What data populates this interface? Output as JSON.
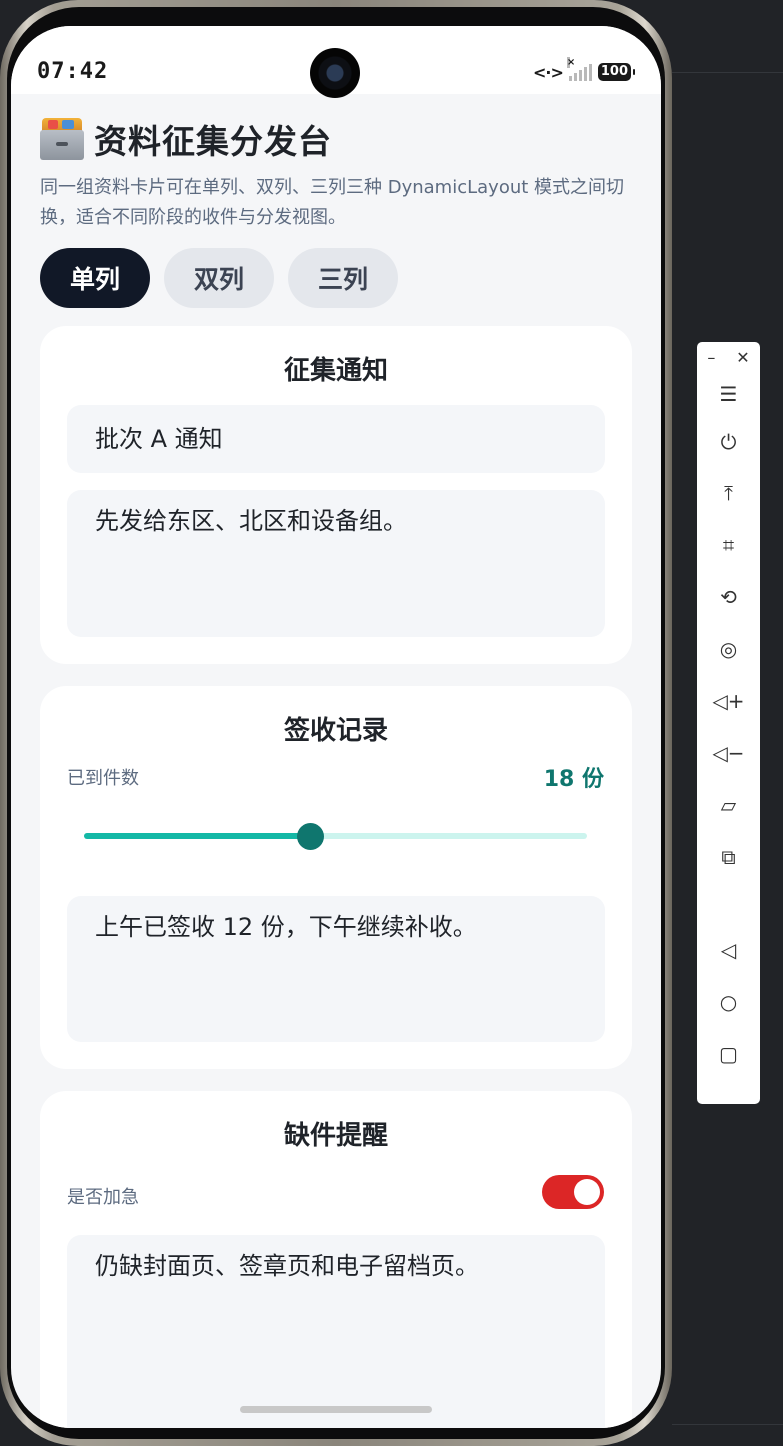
{
  "status_bar": {
    "time": "07:42",
    "battery": "100"
  },
  "header": {
    "title": "资料征集分发台",
    "subtitle": "同一组资料卡片可在单列、双列、三列三种 DynamicLayout 模式之间切换，适合不同阶段的收件与分发视图。"
  },
  "tabs": [
    {
      "label": "单列",
      "active": true
    },
    {
      "label": "双列",
      "active": false
    },
    {
      "label": "三列",
      "active": false
    }
  ],
  "cards": {
    "notice": {
      "title": "征集通知",
      "input_value": "批次 A 通知",
      "textarea_value": "先发给东区、北区和设备组。"
    },
    "receipt": {
      "title": "签收记录",
      "count_label": "已到件数",
      "count_value": "18 份",
      "slider_fraction": 0.45,
      "textarea_value": "上午已签收 12 份，下午继续补收。"
    },
    "missing": {
      "title": "缺件提醒",
      "urgent_label": "是否加急",
      "urgent_on": true,
      "textarea_value": "仍缺封面页、签章页和电子留档页。"
    }
  },
  "colors": {
    "accent": "#0f766e",
    "slider_fill": "#14b8a6",
    "toggle_on": "#dc2626",
    "tab_active": "#111827"
  },
  "side_toolbar": {
    "items": [
      "menu-icon",
      "power-icon",
      "pin-top-icon",
      "crop-icon",
      "rotate-icon",
      "screenshot-icon",
      "volume-up-icon",
      "volume-down-icon",
      "shake-icon",
      "multi-device-icon",
      "back-icon",
      "home-icon",
      "recents-icon"
    ]
  }
}
